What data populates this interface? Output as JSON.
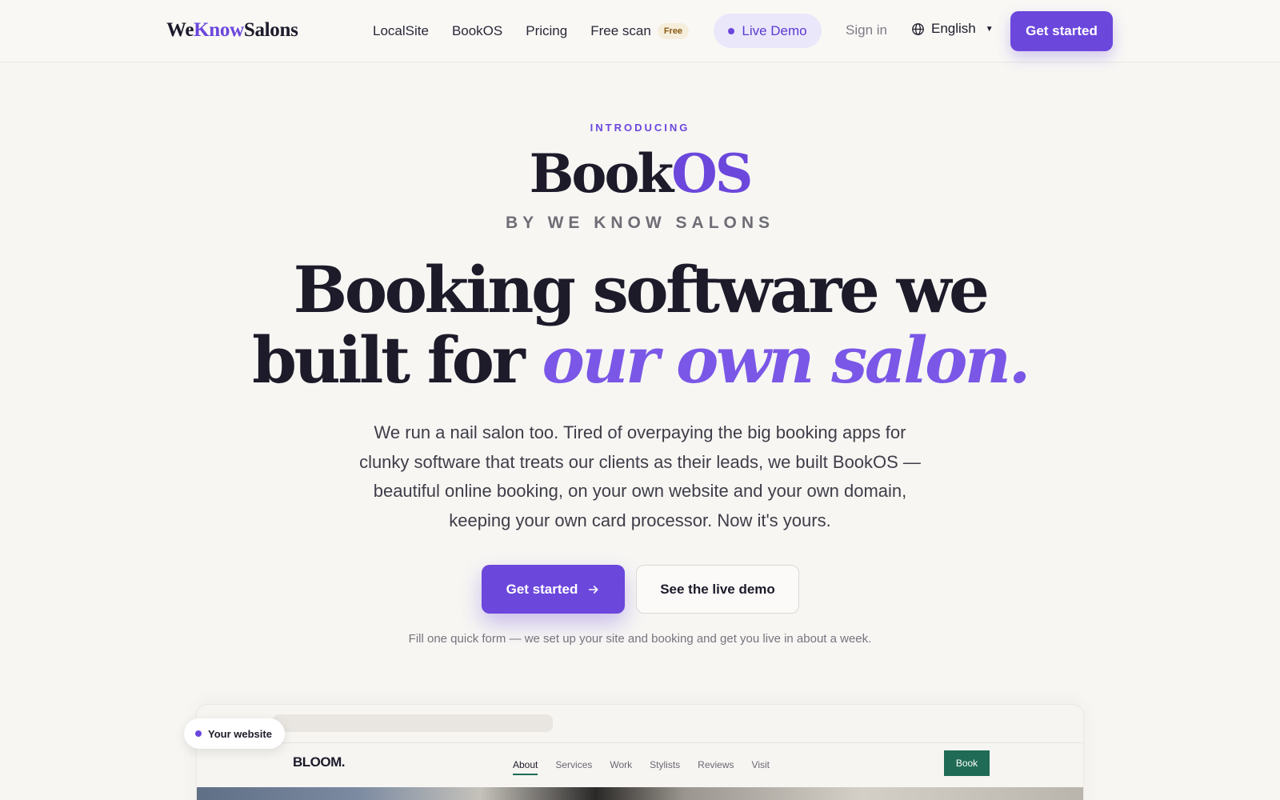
{
  "header": {
    "logo": {
      "part1": "We",
      "part2": "Know",
      "part3": "Salons"
    },
    "nav": [
      "LocalSite",
      "BookOS",
      "Pricing",
      "Free scan"
    ],
    "free_badge": "Free",
    "live_demo": "Live Demo",
    "sign_in": "Sign in",
    "language": "English",
    "cta": "Get started",
    "icons": {
      "language": "globe-icon",
      "language_caret": "caret-down-icon",
      "live_dot": "status-dot-icon"
    }
  },
  "hero": {
    "eyebrow": "INTRODUCING",
    "product": {
      "part1": "Book",
      "part2": "OS"
    },
    "byline": "BY WE KNOW SALONS",
    "headline": {
      "line1": "Booking software we",
      "line2_plain": "built for ",
      "line2_accent": "our own salon."
    },
    "lede": "We run a nail salon too. Tired of overpaying the big booking apps for clunky software that treats our clients as their leads, we built BookOS — beautiful online booking, on your own website and your own domain, keeping your own card processor. Now it's yours.",
    "primary_cta": "Get started",
    "secondary_cta": "See the live demo",
    "fineprint": "Fill one quick form — we set up your site and booking and get you live in about a week.",
    "icons": {
      "primary_cta": "arrow-right-icon"
    }
  },
  "preview": {
    "tag": "Your website",
    "brand": "BLOOM.",
    "nav": [
      "About",
      "Services",
      "Work",
      "Stylists",
      "Reviews",
      "Visit"
    ],
    "active_nav": "About",
    "book": "Book"
  },
  "colors": {
    "accent": "#6b47dc",
    "preview_accent": "#1f6b55",
    "background": "#f7f6f3"
  }
}
